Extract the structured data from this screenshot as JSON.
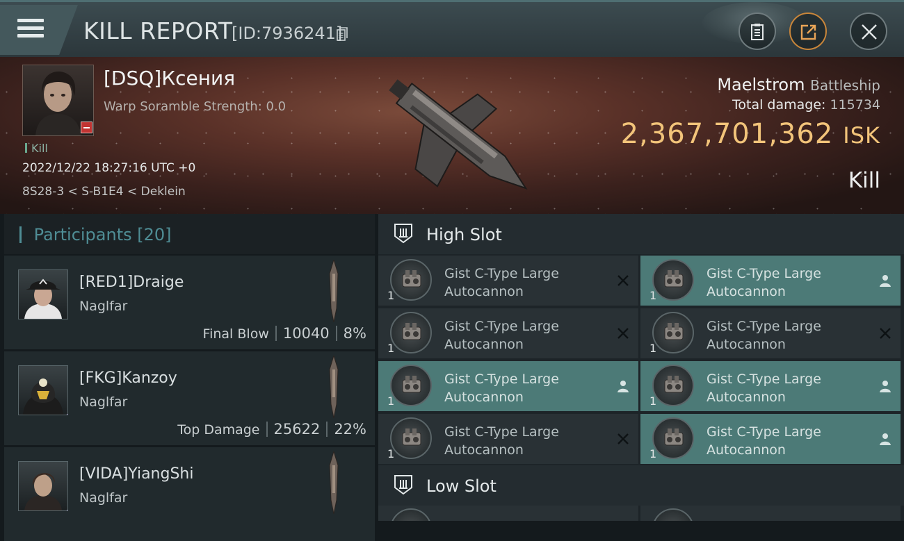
{
  "header": {
    "title": "KILL REPORT",
    "id_label": "[ID:7936241]"
  },
  "victim": {
    "name": "[DSQ]Ксения",
    "warp_scramble": "Warp Soramble Strength: 0.0",
    "kill_tag": "Kill",
    "datetime": "2022/12/22 18:27:16 UTC +0",
    "location": "8S28-3 < S-B1E4 < Deklein",
    "ship_name": "Maelstrom",
    "ship_class": "Battleship",
    "total_damage_label": "Total damage:",
    "total_damage": "115734",
    "isk_value": "2,367,701,362",
    "isk_unit": "ISK",
    "result": "Kill"
  },
  "participants": {
    "title": "Participants",
    "count": "[20]",
    "items": [
      {
        "name": "[RED1]Draige",
        "ship": "Naglfar",
        "label": "Final Blow",
        "damage": "10040",
        "percent": "8%"
      },
      {
        "name": "[FKG]Kanzoy",
        "ship": "Naglfar",
        "label": "Top Damage",
        "damage": "25622",
        "percent": "22%"
      },
      {
        "name": "[VIDA]YiangShi",
        "ship": "Naglfar"
      }
    ]
  },
  "slots": {
    "high_label": "High Slot",
    "low_label": "Low Slot",
    "high": [
      {
        "name": "Gist C-Type Large Autocannon",
        "qty": "1",
        "status": "destroyed"
      },
      {
        "name": "Gist C-Type Large Autocannon",
        "qty": "1",
        "status": "dropped"
      },
      {
        "name": "Gist C-Type Large Autocannon",
        "qty": "1",
        "status": "destroyed"
      },
      {
        "name": "Gist C-Type Large Autocannon",
        "qty": "1",
        "status": "destroyed"
      },
      {
        "name": "Gist C-Type Large Autocannon",
        "qty": "1",
        "status": "dropped"
      },
      {
        "name": "Gist C-Type Large Autocannon",
        "qty": "1",
        "status": "dropped"
      },
      {
        "name": "Gist C-Type Large Autocannon",
        "qty": "1",
        "status": "destroyed"
      },
      {
        "name": "Gist C-Type Large Autocannon",
        "qty": "1",
        "status": "dropped"
      }
    ]
  },
  "colors": {
    "accent_teal": "#4f8d95",
    "isk_gold": "#f2c47a",
    "dropped_bg": "#4c7a77",
    "destroyed_bg": "#293135"
  },
  "icons": [
    "menu-icon",
    "copy-icon",
    "clipboard-icon",
    "share-icon",
    "close-icon",
    "high-slot-icon",
    "low-slot-icon",
    "destroyed-x-icon",
    "dropped-person-icon"
  ]
}
